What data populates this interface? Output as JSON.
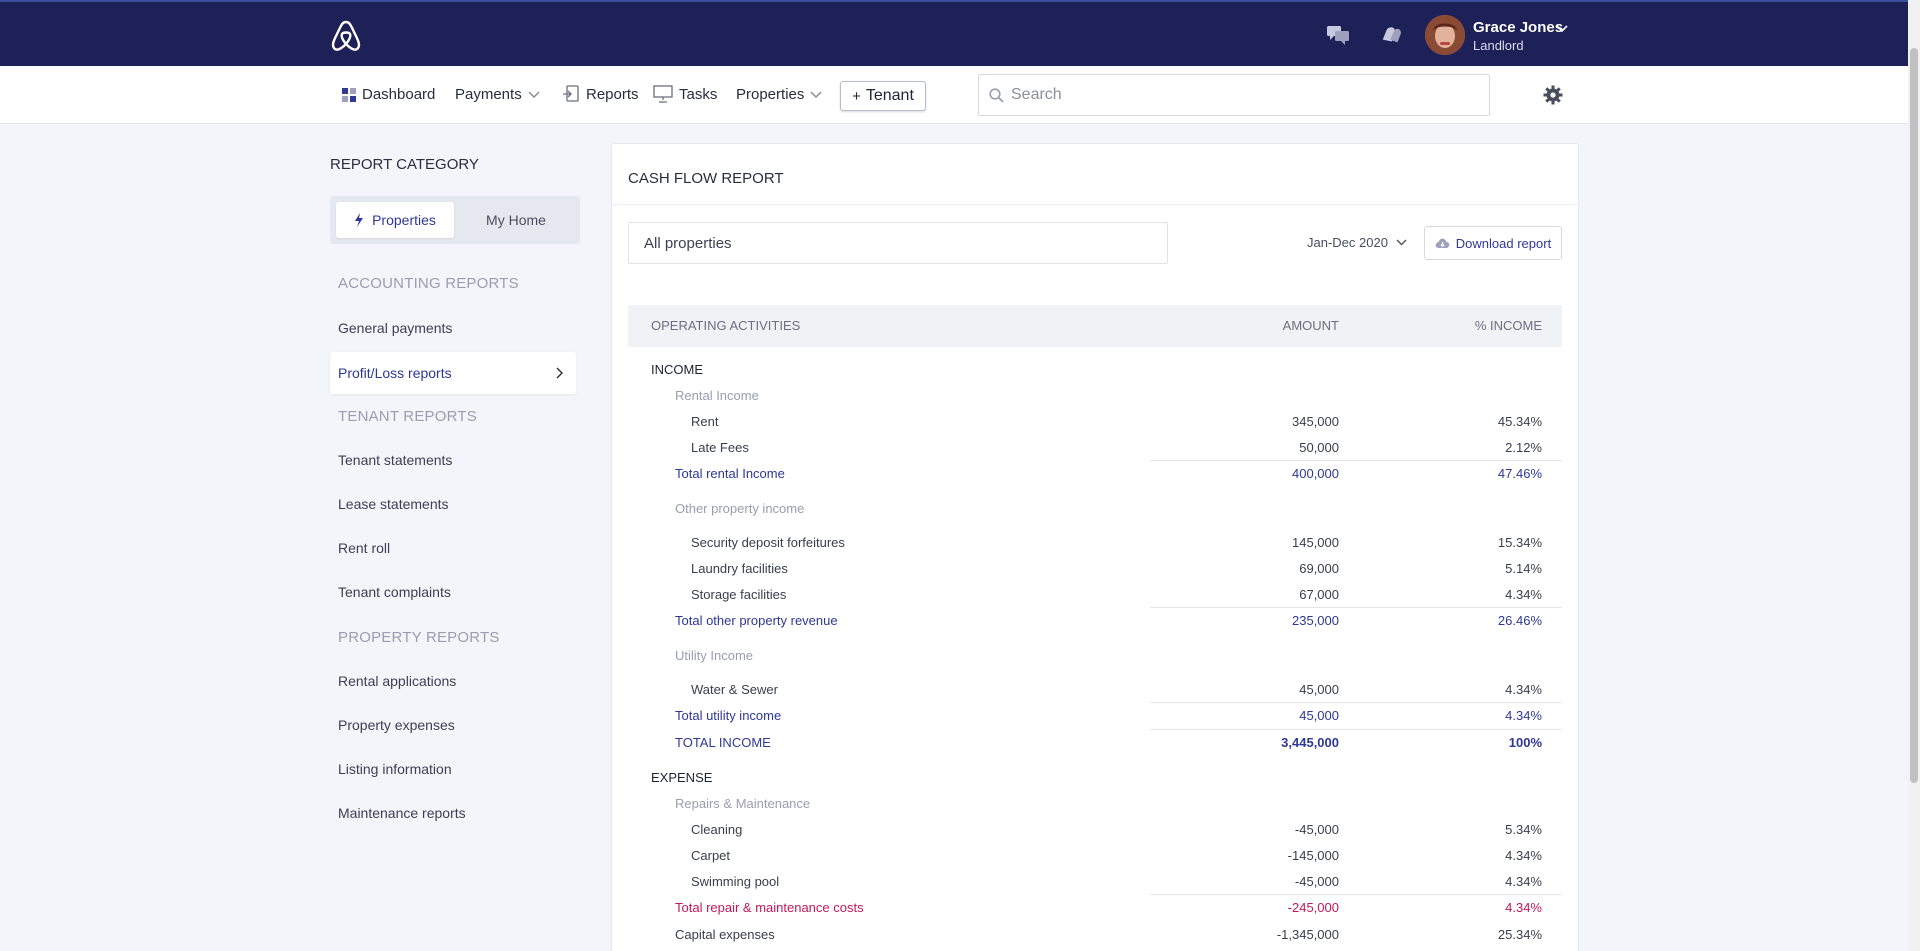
{
  "header": {
    "user_name": "Grace Jones",
    "user_role": "Landlord"
  },
  "nav": {
    "dashboard": "Dashboard",
    "payments": "Payments",
    "reports": "Reports",
    "tasks": "Tasks",
    "properties": "Properties",
    "tenant_button": "Tenant",
    "search_placeholder": "Search"
  },
  "sidebar": {
    "title": "REPORT CATEGORY",
    "seg_properties": "Properties",
    "seg_myhome": "My Home",
    "accounting_group": "ACCOUNTING REPORTS",
    "general_payments": "General payments",
    "profit_loss": "Profit/Loss reports",
    "tenant_group": "TENANT REPORTS",
    "tenant_statements": "Tenant statements",
    "lease_statements": "Lease statements",
    "rent_roll": "Rent roll",
    "tenant_complaints": "Tenant complaints",
    "property_group": "PROPERTY REPORTS",
    "rental_applications": "Rental applications",
    "property_expenses": "Property expenses",
    "listing_information": "Listing information",
    "maintenance_reports": "Maintenance reports"
  },
  "report": {
    "title": "CASH FLOW REPORT",
    "property_filter": "All properties",
    "date_range": "Jan-Dec 2020",
    "download": "Download report",
    "col_activities": "OPERATING ACTIVITIES",
    "col_amount": "AMOUNT",
    "col_percent": "% INCOME",
    "rows": {
      "income": "INCOME",
      "rental_income": "Rental Income",
      "rent": {
        "label": "Rent",
        "amount": "345,000",
        "pct": "45.34%"
      },
      "late_fees": {
        "label": "Late Fees",
        "amount": "50,000",
        "pct": "2.12%"
      },
      "total_rental": {
        "label": "Total rental Income",
        "amount": "400,000",
        "pct": "47.46%"
      },
      "other_property_income": "Other property income",
      "security": {
        "label": "Security deposit forfeitures",
        "amount": "145,000",
        "pct": "15.34%"
      },
      "laundry": {
        "label": "Laundry facilities",
        "amount": "69,000",
        "pct": "5.14%"
      },
      "storage": {
        "label": "Storage facilities",
        "amount": "67,000",
        "pct": "4.34%"
      },
      "total_other": {
        "label": "Total other property revenue",
        "amount": "235,000",
        "pct": "26.46%"
      },
      "utility_income": "Utility Income",
      "water": {
        "label": "Water & Sewer",
        "amount": "45,000",
        "pct": "4.34%"
      },
      "total_utility": {
        "label": "Total utility income",
        "amount": "45,000",
        "pct": "4.34%"
      },
      "total_income": {
        "label": "TOTAL INCOME",
        "amount": "3,445,000",
        "pct": "100%"
      },
      "expense": "EXPENSE",
      "repairs": "Repairs & Maintenance",
      "cleaning": {
        "label": "Cleaning",
        "amount": "-45,000",
        "pct": "5.34%"
      },
      "carpet": {
        "label": "Carpet",
        "amount": "-145,000",
        "pct": "4.34%"
      },
      "pool": {
        "label": "Swimming pool",
        "amount": "-45,000",
        "pct": "4.34%"
      },
      "total_repair": {
        "label": "Total repair & maintenance costs",
        "amount": "-245,000",
        "pct": "4.34%"
      },
      "capex": {
        "label": "Capital expenses",
        "amount": "-1,345,000",
        "pct": "25.34%"
      }
    }
  },
  "colors": {
    "header_bg": "#1e2157",
    "accent": "#2f3894",
    "negative_total": "#c2185b"
  }
}
